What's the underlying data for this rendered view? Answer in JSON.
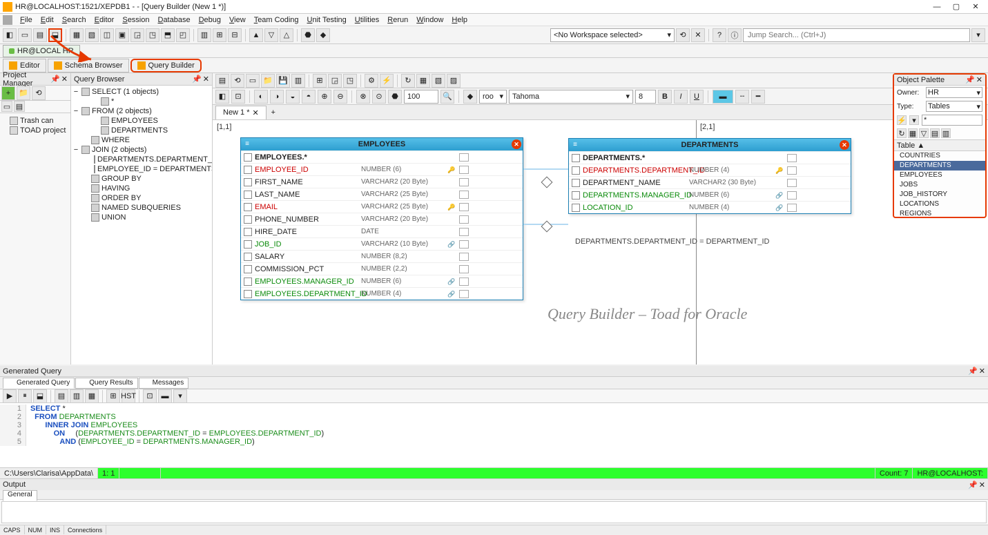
{
  "title": "HR@LOCALHOST:1521/XEPDB1 -                                                  - [Query Builder (New 1 *)]",
  "window_controls": {
    "min": "—",
    "max": "▢",
    "close": "✕"
  },
  "menu": [
    "File",
    "Edit",
    "Search",
    "Editor",
    "Session",
    "Database",
    "Debug",
    "View",
    "Team Coding",
    "Unit Testing",
    "Utilities",
    "Rerun",
    "Window",
    "Help"
  ],
  "workspace_combo": "<No Workspace selected>",
  "jump_search_placeholder": "Jump Search... (Ctrl+J)",
  "connection_tab": "HR@LOCAL HR",
  "editor_tabs": [
    {
      "label": "Editor",
      "icon": "editor-icon"
    },
    {
      "label": "Schema Browser",
      "icon": "schema-icon"
    },
    {
      "label": "Query Builder",
      "icon": "qb-icon",
      "highlight": true
    }
  ],
  "project_manager": {
    "title": "Project Manager",
    "nodes": [
      "Trash can",
      "TOAD project"
    ]
  },
  "query_browser": {
    "title": "Query Browser",
    "tree": [
      {
        "label": "SELECT  (1 objects)",
        "icon": "select",
        "indent": 0,
        "caret": "−"
      },
      {
        "label": "*",
        "icon": "star",
        "indent": 2
      },
      {
        "label": "FROM  (2 objects)",
        "icon": "from",
        "indent": 0,
        "caret": "−"
      },
      {
        "label": "EMPLOYEES",
        "icon": "table",
        "indent": 2
      },
      {
        "label": "DEPARTMENTS",
        "icon": "table",
        "indent": 2
      },
      {
        "label": "WHERE",
        "icon": "where",
        "indent": 1
      },
      {
        "label": "JOIN  (2 objects)",
        "icon": "join",
        "indent": 0,
        "caret": "−"
      },
      {
        "label": "DEPARTMENTS.DEPARTMENT_ID = EMP",
        "icon": "joincond",
        "indent": 2
      },
      {
        "label": "EMPLOYEE_ID = DEPARTMENTS.MANAG",
        "icon": "joincond",
        "indent": 2
      },
      {
        "label": "GROUP BY",
        "icon": "group",
        "indent": 1
      },
      {
        "label": "HAVING",
        "icon": "having",
        "indent": 1
      },
      {
        "label": "ORDER BY",
        "icon": "order",
        "indent": 1
      },
      {
        "label": "NAMED SUBQUERIES",
        "icon": "subq",
        "indent": 1
      },
      {
        "label": "UNION",
        "icon": "union",
        "indent": 1
      }
    ]
  },
  "canvas": {
    "doc_tab": "New 1 *",
    "coord_left": "[1,1]",
    "coord_right": "[2,1]",
    "font": "Tahoma",
    "font_size": "8",
    "zoom": "100",
    "join_text": "DEPARTMENTS.DEPARTMENT_ID = DEPARTMENT_ID",
    "watermark": "Query Builder – Toad for Oracle"
  },
  "employees_table": {
    "title": "EMPLOYEES",
    "rows": [
      {
        "name": "EMPLOYEES.*",
        "type": "",
        "cls": "col-bold",
        "key": ""
      },
      {
        "name": "EMPLOYEE_ID",
        "type": "NUMBER (6)",
        "cls": "col-red",
        "key": "pk"
      },
      {
        "name": "FIRST_NAME",
        "type": "VARCHAR2 (20 Byte)",
        "cls": "",
        "key": ""
      },
      {
        "name": "LAST_NAME",
        "type": "VARCHAR2 (25 Byte)",
        "cls": "",
        "key": ""
      },
      {
        "name": "EMAIL",
        "type": "VARCHAR2 (25 Byte)",
        "cls": "col-red",
        "key": "pk"
      },
      {
        "name": "PHONE_NUMBER",
        "type": "VARCHAR2 (20 Byte)",
        "cls": "",
        "key": ""
      },
      {
        "name": "HIRE_DATE",
        "type": "DATE",
        "cls": "",
        "key": ""
      },
      {
        "name": "JOB_ID",
        "type": "VARCHAR2 (10 Byte)",
        "cls": "col-green",
        "key": "fk"
      },
      {
        "name": "SALARY",
        "type": "NUMBER (8,2)",
        "cls": "",
        "key": ""
      },
      {
        "name": "COMMISSION_PCT",
        "type": "NUMBER (2,2)",
        "cls": "",
        "key": ""
      },
      {
        "name": "EMPLOYEES.MANAGER_ID",
        "type": "NUMBER (6)",
        "cls": "col-green",
        "key": "fk"
      },
      {
        "name": "EMPLOYEES.DEPARTMENT_ID",
        "type": "NUMBER (4)",
        "cls": "col-green",
        "key": "fk"
      }
    ]
  },
  "departments_table": {
    "title": "DEPARTMENTS",
    "rows": [
      {
        "name": "DEPARTMENTS.*",
        "type": "",
        "cls": "col-bold",
        "key": ""
      },
      {
        "name": "DEPARTMENTS.DEPARTMENT_ID",
        "type": "NUMBER (4)",
        "cls": "col-red",
        "key": "pk"
      },
      {
        "name": "DEPARTMENT_NAME",
        "type": "VARCHAR2 (30 Byte)",
        "cls": "",
        "key": ""
      },
      {
        "name": "DEPARTMENTS.MANAGER_ID",
        "type": "NUMBER (6)",
        "cls": "col-green",
        "key": "fk"
      },
      {
        "name": "LOCATION_ID",
        "type": "NUMBER (4)",
        "cls": "col-green",
        "key": "fk"
      }
    ]
  },
  "object_palette": {
    "title": "Object Palette",
    "owner_label": "Owner:",
    "owner": "HR",
    "type_label": "Type:",
    "type": "Tables",
    "filter": "*",
    "col_header": "Table ▲",
    "items": [
      "COUNTRIES",
      "DEPARTMENTS",
      "EMPLOYEES",
      "JOBS",
      "JOB_HISTORY",
      "LOCATIONS",
      "REGIONS"
    ],
    "selected": "DEPARTMENTS"
  },
  "generated": {
    "title": "Generated Query",
    "tabs": [
      "Generated Query",
      "Query Results",
      "Messages"
    ],
    "sql": [
      {
        "n": 1,
        "tokens": [
          {
            "t": "SELECT ",
            "c": "kw"
          },
          {
            "t": "*",
            "c": ""
          }
        ]
      },
      {
        "n": 2,
        "tokens": [
          {
            "t": "  FROM ",
            "c": "kw"
          },
          {
            "t": "DEPARTMENTS",
            "c": "id"
          }
        ]
      },
      {
        "n": 3,
        "tokens": [
          {
            "t": "       INNER JOIN ",
            "c": "kw"
          },
          {
            "t": "EMPLOYEES",
            "c": "id"
          }
        ]
      },
      {
        "n": 4,
        "tokens": [
          {
            "t": "           ON     ",
            "c": "kw"
          },
          {
            "t": "(",
            "c": ""
          },
          {
            "t": "DEPARTMENTS.DEPARTMENT_ID",
            "c": "id"
          },
          {
            "t": " = ",
            "c": ""
          },
          {
            "t": "EMPLOYEES.DEPARTMENT_ID",
            "c": "id"
          },
          {
            "t": ")",
            "c": ""
          }
        ]
      },
      {
        "n": 5,
        "tokens": [
          {
            "t": "              AND ",
            "c": "kw"
          },
          {
            "t": "(",
            "c": ""
          },
          {
            "t": "EMPLOYEE_ID",
            "c": "id"
          },
          {
            "t": " = ",
            "c": ""
          },
          {
            "t": "DEPARTMENTS.MANAGER_ID",
            "c": "id"
          },
          {
            "t": ")",
            "c": ""
          }
        ]
      }
    ]
  },
  "statusbar": {
    "path": "C:\\Users\\Clarisa\\AppData\\",
    "pos": "1:  1",
    "count": "Count: 7",
    "conn": "HR@LOCALHOST:"
  },
  "output_title": "Output",
  "output_tab": "General",
  "bottom_tabs": [
    "CAPS",
    "NUM",
    "INS",
    "Connections"
  ]
}
